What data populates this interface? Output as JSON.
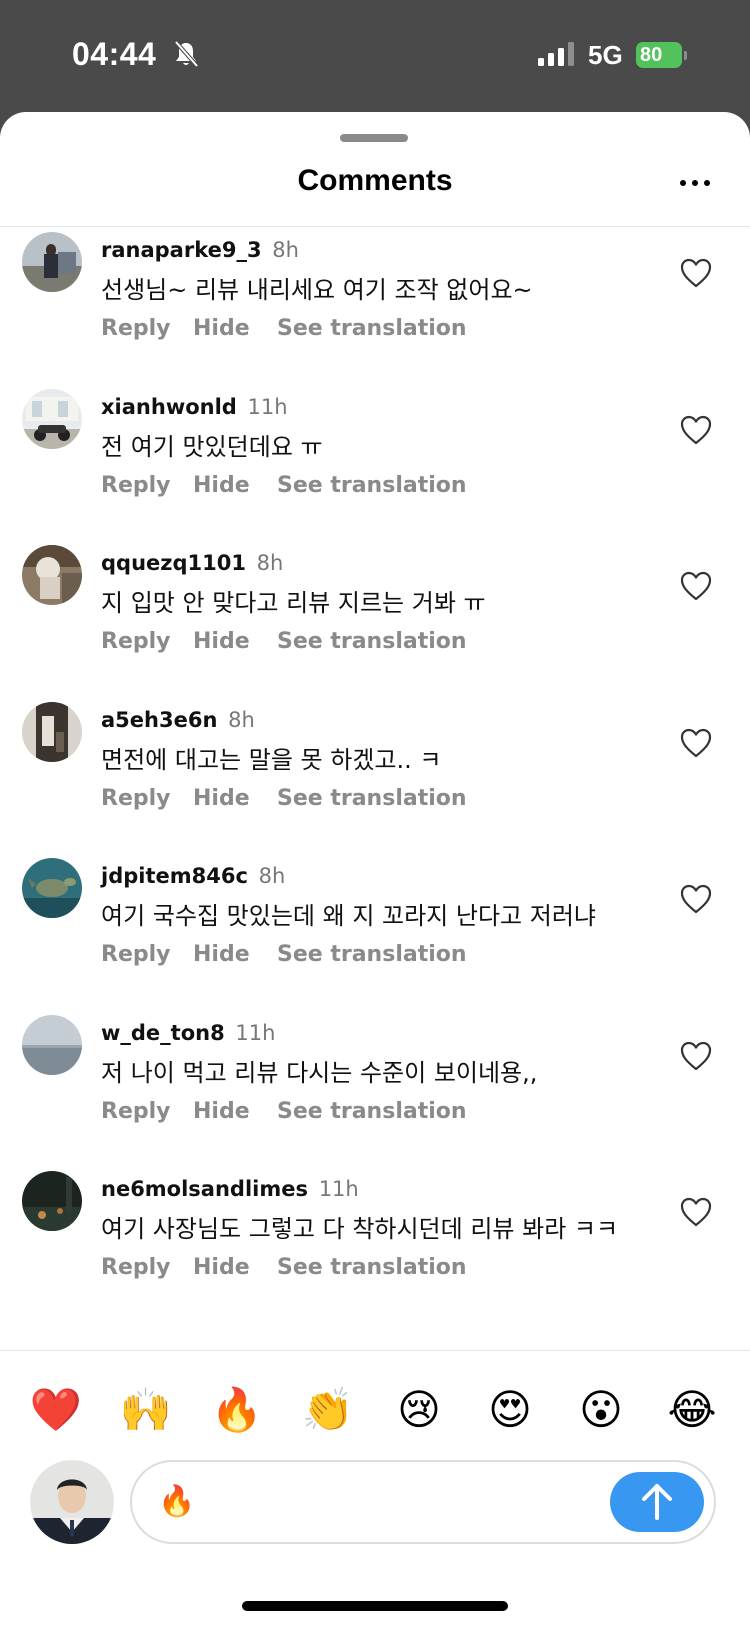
{
  "status_bar": {
    "time": "04:44",
    "network": "5G",
    "battery": "80"
  },
  "sheet": {
    "title": "Comments",
    "menu_icon": "more-horizontal-icon"
  },
  "comments": [
    {
      "username": "ranaparke9_3",
      "time": "8h",
      "text": "선생님~ 리뷰 내리세요 여기 조작 없어요~",
      "reply": "Reply",
      "hide": "Hide",
      "translate": "See translation"
    },
    {
      "username": "xianhwonld",
      "time": "11h",
      "text": "전 여기 맛있던데요 ㅠ",
      "reply": "Reply",
      "hide": "Hide",
      "translate": "See translation"
    },
    {
      "username": "qquezq1101",
      "time": "8h",
      "text": "지 입맛 안 맞다고 리뷰 지르는 거봐 ㅠ",
      "reply": "Reply",
      "hide": "Hide",
      "translate": "See translation"
    },
    {
      "username": "a5eh3e6n",
      "time": "8h",
      "text": "면전에 대고는 말을 못 하겠고.. ㅋ",
      "reply": "Reply",
      "hide": "Hide",
      "translate": "See translation"
    },
    {
      "username": "jdpitem846c",
      "time": "8h",
      "text": "여기 국수집 맛있는데 왜 지 꼬라지 난다고 저러냐",
      "reply": "Reply",
      "hide": "Hide",
      "translate": "See translation"
    },
    {
      "username": "w_de_ton8",
      "time": "11h",
      "text": "저 나이 먹고 리뷰 다시는 수준이 보이네용,,",
      "reply": "Reply",
      "hide": "Hide",
      "translate": "See translation"
    },
    {
      "username": "ne6molsandlimes",
      "time": "11h",
      "text": "여기 사장님도 그렇고 다 착하시던데 리뷰 봐라 ㅋㅋ",
      "reply": "Reply",
      "hide": "Hide",
      "translate": "See translation"
    }
  ],
  "emoji_bar": [
    "❤️",
    "🙌",
    "🔥",
    "👏",
    "😢",
    "😍",
    "😮",
    "😂"
  ],
  "composer": {
    "value": "🔥",
    "send_icon": "arrow-up-icon"
  },
  "colors": {
    "accent": "#3897f0",
    "battery": "#52c35c",
    "muted": "#8a8a8a"
  }
}
